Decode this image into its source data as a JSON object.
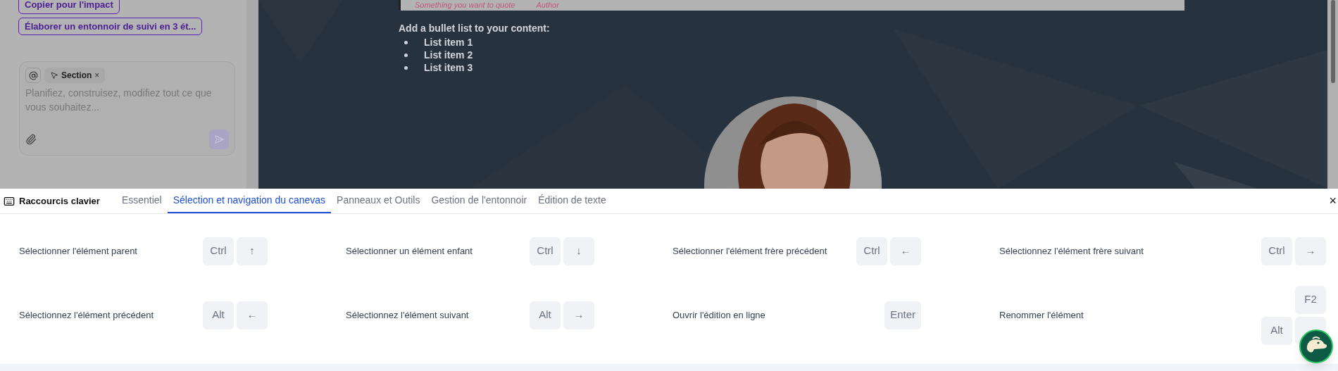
{
  "assistant": {
    "suggestions": [
      "Copier pour l'impact",
      "Élaborer un entonnoir de suivi en 3 ét..."
    ],
    "composer": {
      "context_chip": "Section",
      "context_remove": "×",
      "placeholder": "Planifiez, construisez, modifiez tout ce que vous souhaitez..."
    }
  },
  "canvas": {
    "quote": {
      "text": "Something you want to quote",
      "author": "Author"
    },
    "list_heading": "Add a bullet list to your content:",
    "list_items": [
      "List item 1",
      "List item 2",
      "List item 3"
    ],
    "portrait": {
      "kind": "picture"
    }
  },
  "shortcuts_panel": {
    "title": "Raccourcis clavier",
    "close": "×",
    "tabs": [
      {
        "label": "Essentiel",
        "selected": false
      },
      {
        "label": "Sélection et navigation du canevas",
        "selected": true
      },
      {
        "label": "Panneaux et Outils",
        "selected": false
      },
      {
        "label": "Gestion de l'entonnoir",
        "selected": false
      },
      {
        "label": "Édition de texte",
        "selected": false
      }
    ],
    "rows": [
      [
        {
          "label": "Sélectionner l'élément parent",
          "keys": [
            "Ctrl",
            "↑"
          ]
        },
        {
          "label": "Sélectionner un élément enfant",
          "keys": [
            "Ctrl",
            "↓"
          ]
        },
        {
          "label": "Sélectionner l'élément frère précédent",
          "keys": [
            "Ctrl",
            "←"
          ]
        },
        {
          "label": "Sélectionnez l'élément frère suivant",
          "keys": [
            "Ctrl",
            "→"
          ]
        }
      ],
      [
        {
          "label": "Sélectionnez l'élément précédent",
          "keys": [
            "Alt",
            "←"
          ]
        },
        {
          "label": "Sélectionnez l'élément suivant",
          "keys": [
            "Alt",
            "→"
          ]
        },
        {
          "label": "Ouvrir l'édition en ligne",
          "keys": [
            "Enter"
          ]
        },
        {
          "label": "Renommer l'élément",
          "keys": [
            "F2"
          ],
          "alt_keys": [
            "Alt"
          ],
          "covered_key": true
        }
      ]
    ]
  }
}
